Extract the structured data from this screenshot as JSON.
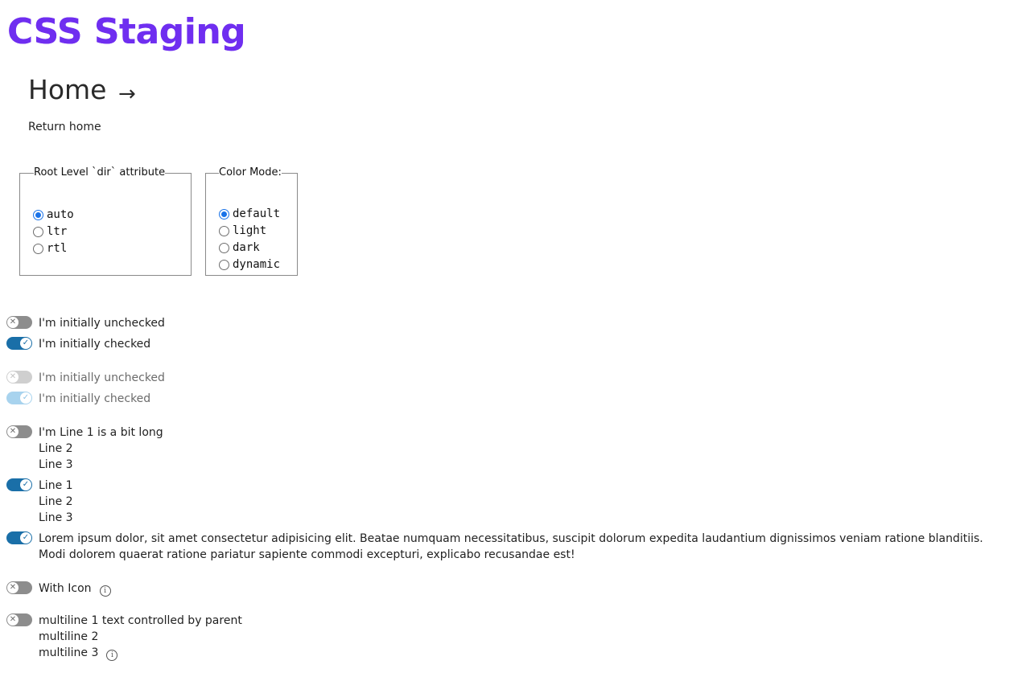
{
  "site": {
    "title": "CSS Staging"
  },
  "page": {
    "heading": "Home",
    "arrow": "→",
    "return_home": "Return home"
  },
  "dir_fieldset": {
    "legend": "Root Level `dir` attribute",
    "options": [
      "auto",
      "ltr",
      "rtl"
    ],
    "selected": "auto"
  },
  "color_fieldset": {
    "legend": "Color Mode:",
    "options": [
      "default",
      "light",
      "dark",
      "dynamic"
    ],
    "selected": "default"
  },
  "toggles": {
    "t1": {
      "label": "I'm initially unchecked",
      "checked": false,
      "disabled": false
    },
    "t2": {
      "label": "I'm initially checked",
      "checked": true,
      "disabled": false
    },
    "t3": {
      "label": "I'm initially unchecked",
      "checked": false,
      "disabled": true
    },
    "t4": {
      "label": "I'm initially checked",
      "checked": true,
      "disabled": true
    },
    "t5": {
      "lines": [
        "I'm Line 1 is a bit long",
        "Line 2",
        "Line 3"
      ],
      "checked": false
    },
    "t6": {
      "lines": [
        "Line 1",
        "Line 2",
        "Line 3"
      ],
      "checked": true
    },
    "t7": {
      "label": "Lorem ipsum dolor, sit amet consectetur adipisicing elit. Beatae numquam necessitatibus, suscipit dolorum expedita laudantium dignissimos veniam ratione blanditiis. Modi dolorem quaerat ratione pariatur sapiente commodi excepturi, explicabo recusandae est!",
      "checked": true
    },
    "t8": {
      "label": "With Icon",
      "checked": false,
      "icon": "info-icon"
    },
    "t9": {
      "lines": [
        "multiline 1 text controlled by parent",
        "multiline 2",
        "multiline 3"
      ],
      "checked": false,
      "icon": "info-icon"
    }
  },
  "icons": {
    "off_glyph": "✕",
    "on_glyph": "✓",
    "info_glyph": "i"
  },
  "colors": {
    "title": "#6f2ef0",
    "switch_on": "#1a6fa8",
    "switch_off": "#8d8d8d",
    "radio_checked": "#1a73e8"
  }
}
